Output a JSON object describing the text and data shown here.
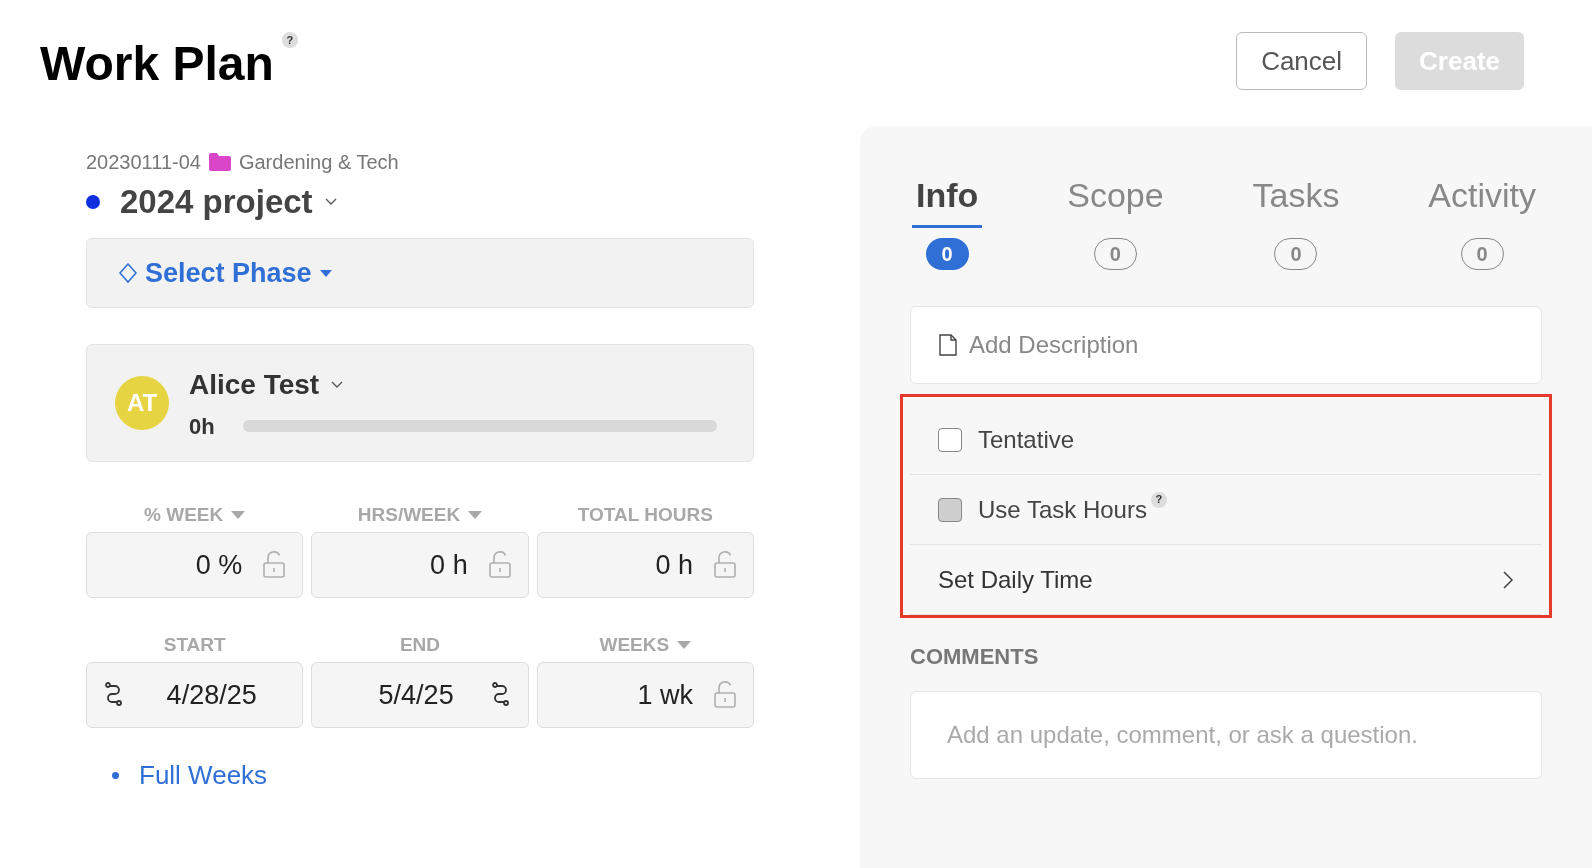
{
  "header": {
    "title": "Work Plan",
    "help": "?",
    "buttons": [
      {
        "label": "Cancel",
        "disabled": false
      },
      {
        "label": "Create",
        "disabled": true
      }
    ]
  },
  "project": {
    "code": "20230111-04",
    "portfolio": "Gardening & Tech",
    "name": "2024 project",
    "color": "#1030e0"
  },
  "phase": {
    "label": "Select Phase"
  },
  "member": {
    "initials": "AT",
    "name": "Alice Test",
    "hours": "0h",
    "level": 0
  },
  "fields": [
    {
      "label": "% WEEK",
      "dropdown": true,
      "value": "0 %",
      "kind": "locked"
    },
    {
      "label": "HRS/WEEK",
      "dropdown": true,
      "value": "0 h",
      "kind": "locked"
    },
    {
      "label": "TOTAL HOURS",
      "dropdown": false,
      "value": "0 h",
      "kind": "locked"
    },
    {
      "label": "START",
      "dropdown": false,
      "value": "4/28/25",
      "kind": "linked_start"
    },
    {
      "label": "END",
      "dropdown": false,
      "value": "5/4/25",
      "kind": "linked_end"
    },
    {
      "label": "WEEKS",
      "dropdown": true,
      "value": "1 wk",
      "kind": "locked"
    }
  ],
  "full_weeks": "Full Weeks",
  "tabs": [
    {
      "label": "Info",
      "count": "0",
      "selected": true
    },
    {
      "label": "Scope",
      "count": "0",
      "selected": false
    },
    {
      "label": "Tasks",
      "count": "0",
      "selected": false
    },
    {
      "label": "Activity",
      "count": "0",
      "selected": false
    }
  ],
  "description": {
    "placeholder": "Add Description"
  },
  "options": [
    {
      "kind": "checkbox",
      "label": "Tentative",
      "checked": false,
      "disabled": false
    },
    {
      "kind": "checkbox",
      "label": "Use Task Hours",
      "checked": false,
      "disabled": true,
      "help": "?"
    },
    {
      "kind": "link",
      "label": "Set Daily Time"
    }
  ],
  "comments": {
    "heading": "COMMENTS",
    "placeholder": "Add an update, comment, or ask a question."
  }
}
